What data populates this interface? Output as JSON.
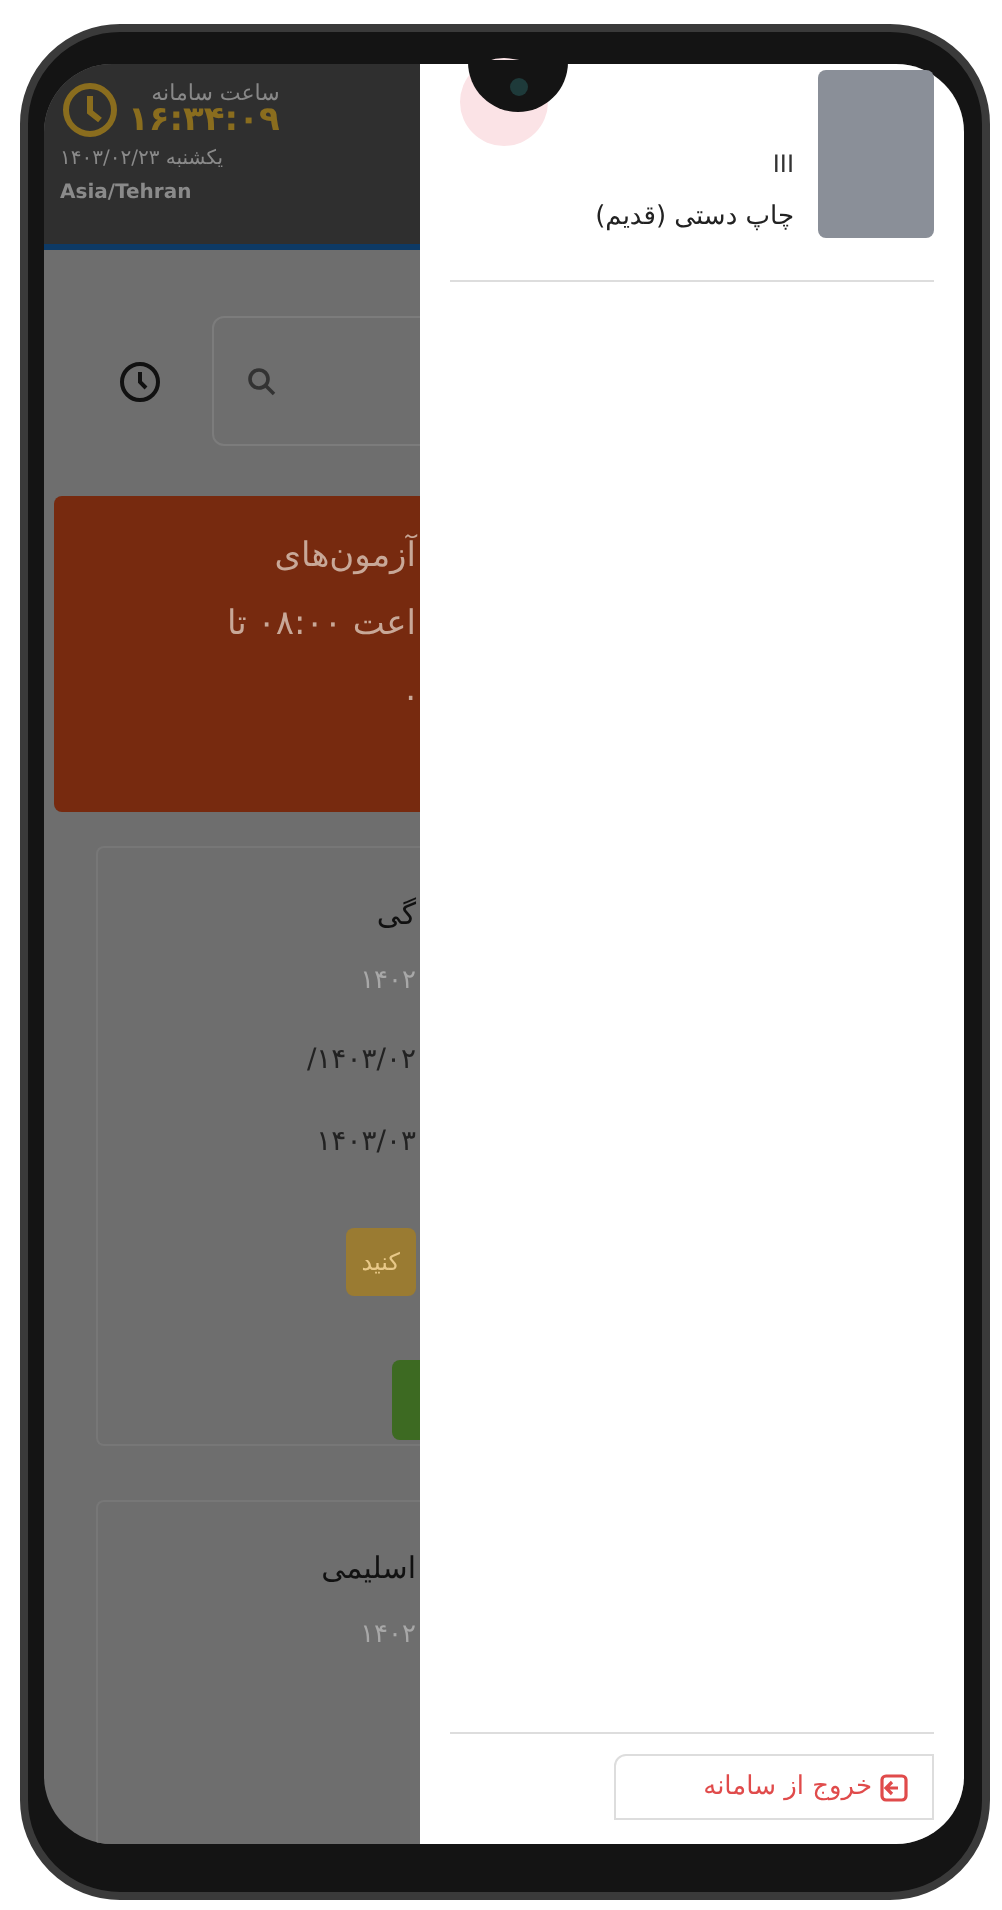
{
  "header": {
    "clock_label": "ساعت سامانه",
    "time": "۱۶:۳۴:۰۹",
    "date": "یکشنبه ۱۴۰۳/۰۲/۲۳",
    "timezone": "Asia/Tehran"
  },
  "banner": {
    "lines": [
      "آزمون‌های",
      "اعت ۰۸:۰۰ تا",
      "."
    ]
  },
  "cards": [
    {
      "title": "گی",
      "subtitle": "۱۴۰۲",
      "dates": [
        "۱۴۰۳/۰۲/",
        "۱۴۰۳/۰۳"
      ],
      "badge": "کنید",
      "has_button": true
    },
    {
      "title": "اسلیمی",
      "subtitle": "۱۴۰۲",
      "has_button": false
    }
  ],
  "drawer": {
    "user_code": "III",
    "user_role": "چاپ دستی (قدیم)",
    "logout": "خروج از سامانه"
  }
}
